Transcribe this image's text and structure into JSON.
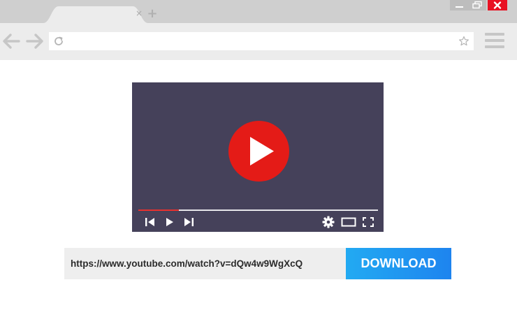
{
  "browser": {
    "tab_close_glyph": "×",
    "new_tab_glyph": "+",
    "icons": {
      "back": "back-arrow-icon",
      "forward": "forward-arrow-icon",
      "reload": "reload-icon",
      "bookmark": "star-icon",
      "menu": "hamburger-menu-icon",
      "minimize": "minimize-icon",
      "maximize": "restore-icon",
      "close": "close-icon"
    },
    "colors": {
      "close_button": "#e81123",
      "titlebar": "#cfcfcf",
      "toolbar": "#ececec"
    }
  },
  "player": {
    "progress": 0.17,
    "colors": {
      "background": "#45415a",
      "play_button": "#e41b17",
      "progress": "#e8312f"
    },
    "controls": [
      "previous-icon",
      "play-icon",
      "next-icon",
      "settings-gear-icon",
      "theater-mode-icon",
      "fullscreen-icon"
    ]
  },
  "downloader": {
    "url": "https://www.youtube.com/watch?v=dQw4w9WgXcQ",
    "button_label": "DOWNLOAD",
    "colors": {
      "button_start": "#22aaf2",
      "button_end": "#1e84ef",
      "input_bg": "#eeeeee"
    }
  }
}
